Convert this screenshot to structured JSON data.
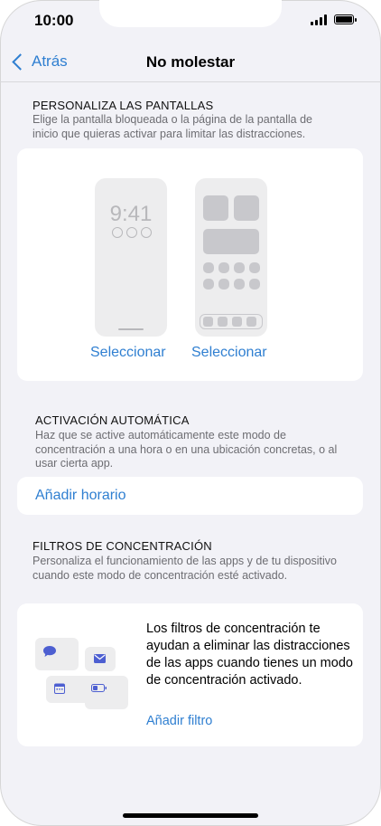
{
  "status": {
    "time": "10:00"
  },
  "nav": {
    "back_label": "Atrás",
    "title": "No molestar"
  },
  "screens_section": {
    "title": "PERSONALIZA LAS PANTALLAS",
    "description": "Elige la pantalla bloqueada o la página de la pantalla de inicio que quieras activar para limitar las distracciones.",
    "lock_preview_time": "9:41",
    "select_lock_label": "Seleccionar",
    "select_home_label": "Seleccionar"
  },
  "auto_section": {
    "title": "ACTIVACIÓN AUTOMÁTICA",
    "description": "Haz que se active automáticamente este modo de concentración a una hora o en una ubicación concretas, o al usar cierta app.",
    "add_schedule_label": "Añadir horario"
  },
  "filters_section": {
    "title": "FILTROS DE CONCENTRACIÓN",
    "description": "Personaliza el funcionamiento de las apps y de tu dispositivo cuando este modo de concentración esté activado.",
    "info_text": "Los filtros de concentración te ayudan a eliminar las distracciones de las apps cuando tienes un modo de concentración activado.",
    "add_filter_label": "Añadir filtro"
  },
  "colors": {
    "accent": "#2f7fd1",
    "icon": "#4d5fd1",
    "background": "#f2f2f7"
  },
  "icons": [
    "chevron-left-icon",
    "chat-bubble-icon",
    "mail-icon",
    "calendar-icon",
    "battery-icon"
  ]
}
